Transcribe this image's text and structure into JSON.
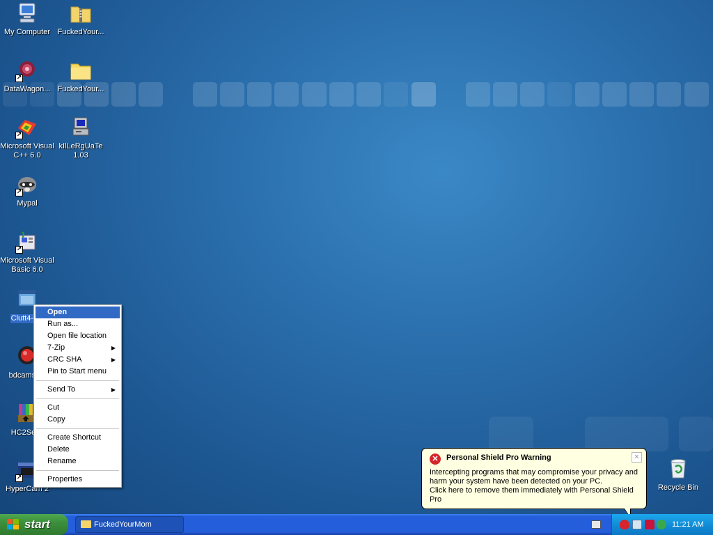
{
  "desktop_icons": [
    {
      "label": "My Computer",
      "icon": "my-computer-icon"
    },
    {
      "label": "FuckedYour...",
      "icon": "zip-folder-icon"
    },
    {
      "label": "DataWagon...",
      "icon": "datawagon-icon"
    },
    {
      "label": "FuckedYour...",
      "icon": "folder-icon"
    },
    {
      "label": "Microsoft Visual\nC++ 6.0",
      "icon": "visual-cpp-icon"
    },
    {
      "label": "kIlLeRgUaTe\n1.03",
      "icon": "computer-program-icon"
    },
    {
      "label": "Mypal",
      "icon": "mypal-icon"
    },
    {
      "label": "Microsoft Visual\nBasic 6.0",
      "icon": "visual-basic-icon"
    },
    {
      "label": "Clutt4-Cl",
      "icon": "application-icon"
    },
    {
      "label": "bdcamse",
      "icon": "bandicam-icon"
    },
    {
      "label": "HC2Set",
      "icon": "installer-icon"
    },
    {
      "label": "HyperCam 2",
      "icon": "hypercam-icon"
    },
    {
      "label": "Recycle Bin",
      "icon": "recycle-bin-icon"
    }
  ],
  "context_menu": {
    "items": [
      "Open",
      "Run as...",
      "Open file location",
      "7-Zip",
      "CRC SHA",
      "Pin to Start menu",
      "Send To",
      "Cut",
      "Copy",
      "Create Shortcut",
      "Delete",
      "Rename",
      "Properties"
    ],
    "highlighted": "Open"
  },
  "balloon": {
    "title": "Personal Shield Pro Warning",
    "text": "Intercepting programs that may compromise your privacy and\nharm your system have been detected on your PC.\nClick here to remove them immediately with Personal Shield Pro",
    "close_label": "×"
  },
  "taskbar": {
    "start_label": "start",
    "window_button": "FuckedYourMom",
    "clock": "11:21 AM"
  },
  "colors": {
    "desktop": "#2a6eac",
    "taskbar": "#245edb",
    "start_button": "#3c8f3c",
    "menu_highlight": "#316ac5",
    "balloon_bg": "#ffffe1",
    "error_red": "#d6252c"
  }
}
